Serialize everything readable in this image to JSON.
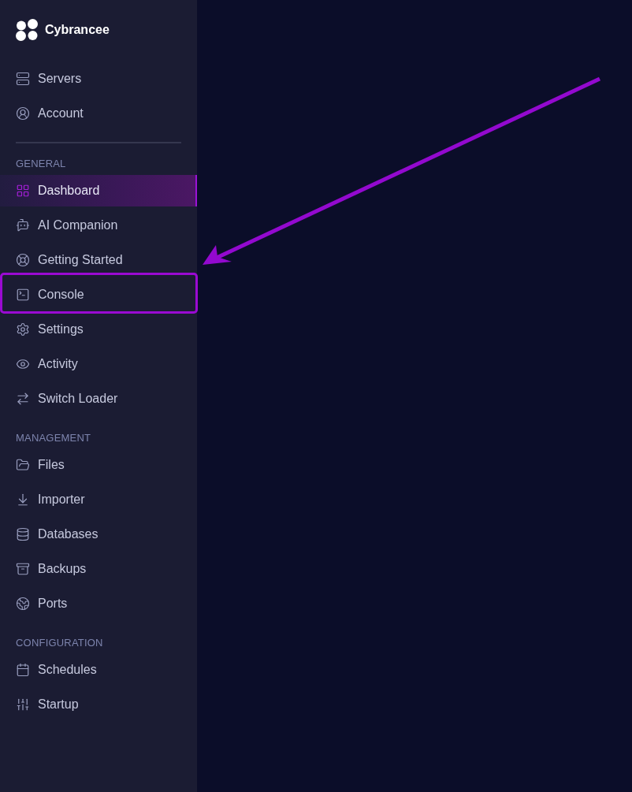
{
  "brand": {
    "name": "Cybrancee"
  },
  "sidebar": {
    "top_items": [
      {
        "label": "Servers",
        "selected": false,
        "highlighted": false
      },
      {
        "label": "Account",
        "selected": false,
        "highlighted": false
      }
    ],
    "sections": [
      {
        "title": "GENERAL",
        "items": [
          {
            "label": "Dashboard",
            "selected": true,
            "highlighted": false
          },
          {
            "label": "AI Companion",
            "selected": false,
            "highlighted": false
          },
          {
            "label": "Getting Started",
            "selected": false,
            "highlighted": false
          },
          {
            "label": "Console",
            "selected": false,
            "highlighted": true
          },
          {
            "label": "Settings",
            "selected": false,
            "highlighted": false
          },
          {
            "label": "Activity",
            "selected": false,
            "highlighted": false
          },
          {
            "label": "Switch Loader",
            "selected": false,
            "highlighted": false
          }
        ]
      },
      {
        "title": "MANAGEMENT",
        "items": [
          {
            "label": "Files",
            "selected": false,
            "highlighted": false
          },
          {
            "label": "Importer",
            "selected": false,
            "highlighted": false
          },
          {
            "label": "Databases",
            "selected": false,
            "highlighted": false
          },
          {
            "label": "Backups",
            "selected": false,
            "highlighted": false
          },
          {
            "label": "Ports",
            "selected": false,
            "highlighted": false
          }
        ]
      },
      {
        "title": "CONFIGURATION",
        "items": [
          {
            "label": "Schedules",
            "selected": false,
            "highlighted": false
          },
          {
            "label": "Startup",
            "selected": false,
            "highlighted": false
          }
        ]
      }
    ]
  }
}
